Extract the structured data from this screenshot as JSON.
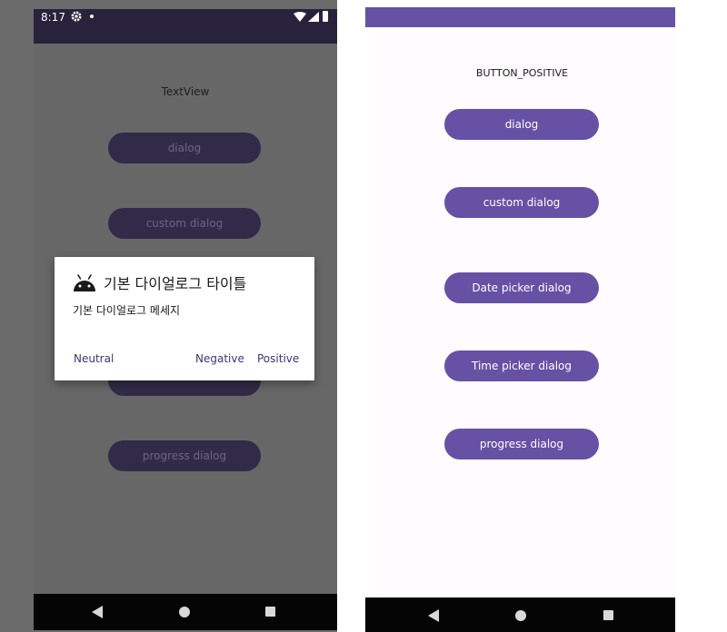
{
  "left_screen": {
    "status_bar": {
      "time": "8:17"
    },
    "text_view": "TextView",
    "buttons": [
      {
        "label": "dialog"
      },
      {
        "label": "custom dialog"
      },
      {
        "label": ""
      },
      {
        "label": "progress dialog"
      }
    ],
    "dialog": {
      "title": "기본 다이얼로그 타이틀",
      "message": "기본 다이얼로그 메세지",
      "neutral": "Neutral",
      "negative": "Negative",
      "positive": "Positive",
      "icon": "android-icon"
    }
  },
  "right_screen": {
    "text_view": "BUTTON_POSITIVE",
    "buttons": [
      {
        "label": "dialog"
      },
      {
        "label": "custom dialog"
      },
      {
        "label": "Date picker dialog"
      },
      {
        "label": "Time picker dialog"
      },
      {
        "label": "progress dialog"
      }
    ]
  },
  "colors": {
    "primary": "#6751a5",
    "dim_button": "#322a49",
    "status_dark": "#28223c",
    "dialog_button_text": "#3f3477"
  },
  "icons": [
    "gear-icon",
    "wifi-icon",
    "signal-icon",
    "battery-icon",
    "back-icon",
    "home-icon",
    "recents-icon",
    "android-icon"
  ]
}
